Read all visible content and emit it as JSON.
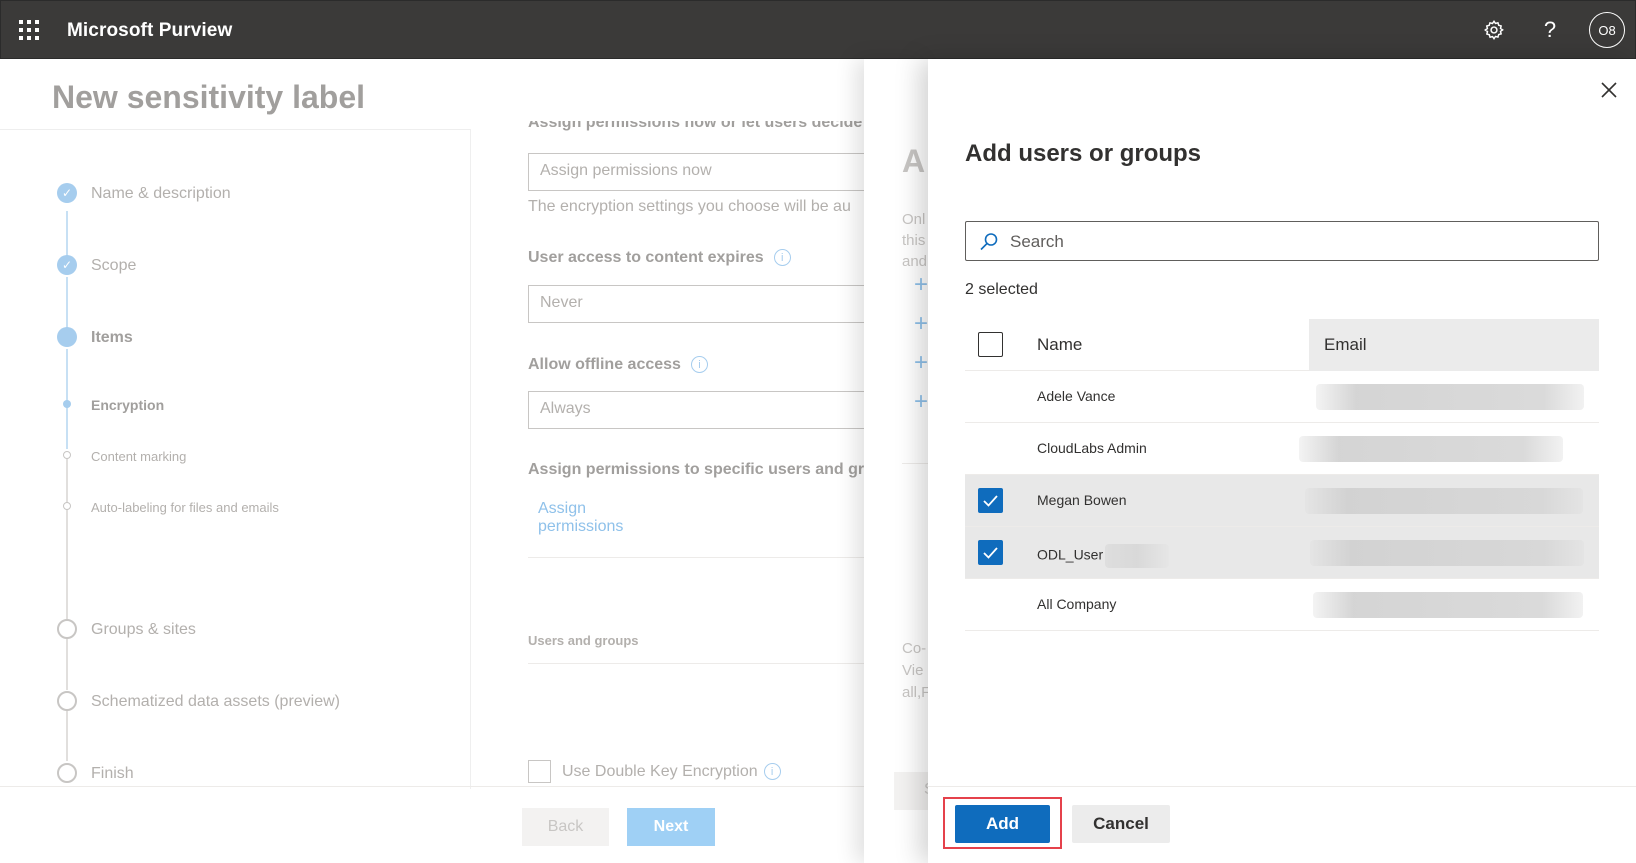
{
  "topbar": {
    "app_title": "Microsoft Purview",
    "settings_icon": "gear-icon",
    "help_icon": "?",
    "avatar_initials": "O8"
  },
  "page": {
    "title": "New sensitivity label",
    "steps": [
      {
        "label": "Name & description",
        "state": "done"
      },
      {
        "label": "Scope",
        "state": "done"
      },
      {
        "label": "Items",
        "state": "current"
      },
      {
        "label": "Encryption",
        "state": "current-sub"
      },
      {
        "label": "Content marking",
        "state": "sub"
      },
      {
        "label": "Auto-labeling for files and emails",
        "state": "sub"
      },
      {
        "label": "Groups & sites",
        "state": "todo"
      },
      {
        "label": "Schematized data assets (preview)",
        "state": "todo"
      },
      {
        "label": "Finish",
        "state": "todo"
      }
    ],
    "form": {
      "assign_heading_partial": "Assign permissions now or let users decide",
      "assign_value": "Assign permissions now",
      "encryption_note": "The encryption settings you choose will be au",
      "expires_label": "User access to content expires",
      "expires_value": "Never",
      "offline_label": "Allow offline access",
      "offline_value": "Always",
      "specific_label": "Assign permissions to specific users and gr",
      "assign_link": "Assign permissions",
      "users_groups_header": "Users and groups",
      "double_key_label": "Use Double Key Encryption"
    },
    "back_button": "Back",
    "next_button": "Next"
  },
  "middle_panel": {
    "title_partial": "A",
    "text_lines": [
      "Onl",
      "this",
      "and"
    ],
    "footer_lines": [
      "Co-",
      "Vie",
      "all,F"
    ],
    "button_partial": "S"
  },
  "modal": {
    "title": "Add users or groups",
    "search_placeholder": "Search",
    "selected_count": "2 selected",
    "columns": {
      "name": "Name",
      "email": "Email"
    },
    "rows": [
      {
        "name": "Adele Vance",
        "checked": false
      },
      {
        "name": "CloudLabs Admin",
        "checked": false
      },
      {
        "name": "Megan Bowen",
        "checked": true
      },
      {
        "name": "ODL_User",
        "checked": true
      },
      {
        "name": "All Company",
        "checked": false
      }
    ],
    "add_button": "Add",
    "cancel_button": "Cancel",
    "colors": {
      "primary": "#0f6cbd",
      "highlight": "#e5414b"
    }
  }
}
